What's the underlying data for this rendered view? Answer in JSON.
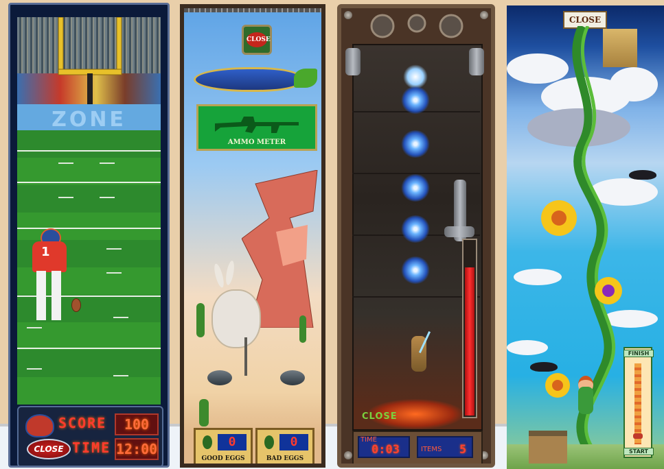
{
  "football": {
    "endzone_text": "ZONE",
    "score_label": "SCORE",
    "score_value": "100",
    "time_label": "TIME",
    "time_value": "12:00",
    "close_label": "CLOSE",
    "jersey_number": "1"
  },
  "desert": {
    "close_label": "CLOSE",
    "ammo_label": "AMMO METER",
    "good_eggs": {
      "label": "GOOD EGGS",
      "count": "0"
    },
    "bad_eggs": {
      "label": "BAD EGGS",
      "count": "0"
    }
  },
  "steampunk": {
    "close_label": "CLOSE",
    "time_label": "TIME",
    "time_value": "0:03",
    "items_label": "ITEMS",
    "items_value": "5",
    "energy_level": 0.85
  },
  "beanstalk": {
    "close_label": "CLOSE",
    "finish_label": "FINISH",
    "start_label": "START",
    "climb_progress": 0.1
  },
  "colors": {
    "led_red": "#ff3b2e",
    "field_green": "#2d8a2d",
    "ammo_green": "#16a33a",
    "sky_blue": "#27b0e4"
  },
  "icons": [
    "helmet-icon",
    "rifle-icon",
    "carrot-icon",
    "egg-icon",
    "castle-icon",
    "crow-icon",
    "flower-icon",
    "robot-icon"
  ]
}
